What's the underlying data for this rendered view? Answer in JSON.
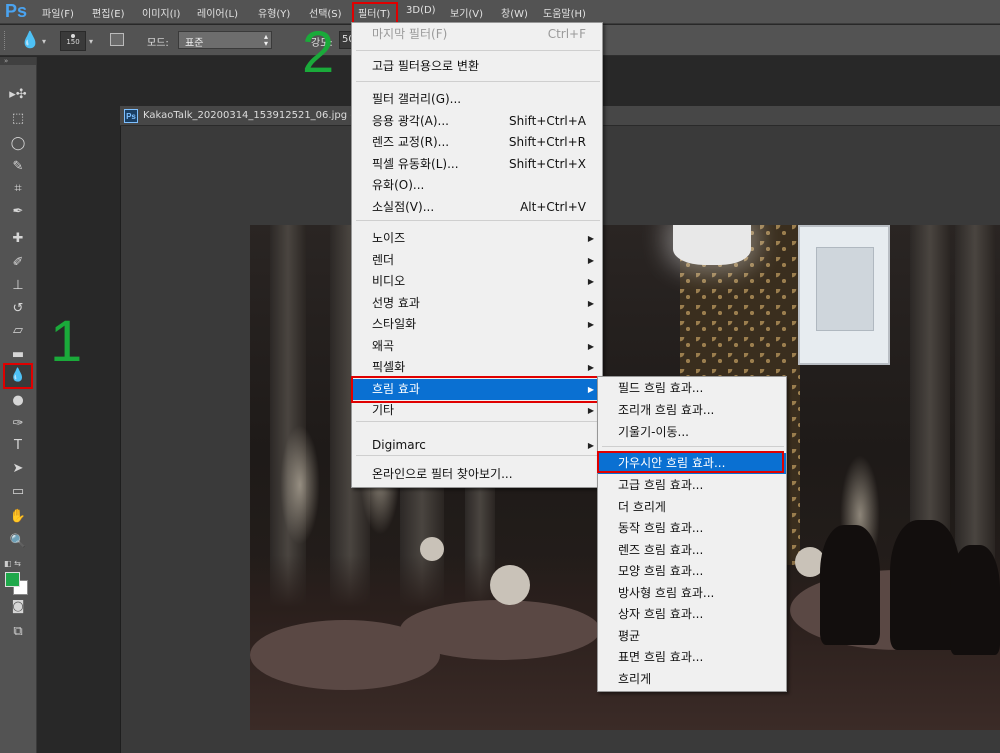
{
  "app": {
    "logo": "Ps"
  },
  "menubar": {
    "items": [
      "파일(F)",
      "편집(E)",
      "이미지(I)",
      "레이어(L)",
      "유형(Y)",
      "선택(S)",
      "필터(T)",
      "3D(D)",
      "보기(V)",
      "창(W)",
      "도움말(H)"
    ]
  },
  "options": {
    "brush_size": "150",
    "mode_label": "모드:",
    "mode_value": "표준",
    "strength_label": "강도:",
    "strength_value": "50"
  },
  "document": {
    "title": "KakaoTalk_20200314_153912521_06.jpg @",
    "icon_text": "Ps"
  },
  "annotations": {
    "step1": "1",
    "step2": "2"
  },
  "filter_menu": {
    "items": [
      {
        "label": "마지막 필터(F)",
        "shortcut": "Ctrl+F",
        "disabled": true
      },
      {
        "label": "고급 필터용으로 변환"
      },
      {
        "label": "필터 갤러리(G)..."
      },
      {
        "label": "응용 광각(A)...",
        "shortcut": "Shift+Ctrl+A"
      },
      {
        "label": "렌즈 교정(R)...",
        "shortcut": "Shift+Ctrl+R"
      },
      {
        "label": "픽셀 유동화(L)...",
        "shortcut": "Shift+Ctrl+X"
      },
      {
        "label": "유화(O)..."
      },
      {
        "label": "소실점(V)...",
        "shortcut": "Alt+Ctrl+V"
      },
      {
        "label": "노이즈",
        "submenu": true
      },
      {
        "label": "렌더",
        "submenu": true
      },
      {
        "label": "비디오",
        "submenu": true
      },
      {
        "label": "선명 효과",
        "submenu": true
      },
      {
        "label": "스타일화",
        "submenu": true
      },
      {
        "label": "왜곡",
        "submenu": true
      },
      {
        "label": "픽셀화",
        "submenu": true
      },
      {
        "label": "흐림 효과",
        "submenu": true,
        "highlighted": true
      },
      {
        "label": "기타",
        "submenu": true
      },
      {
        "label": "Digimarc",
        "submenu": true
      },
      {
        "label": "온라인으로 필터 찾아보기..."
      }
    ]
  },
  "blur_submenu": {
    "items": [
      {
        "label": "필드 흐림 효과..."
      },
      {
        "label": "조리개 흐림 효과..."
      },
      {
        "label": "기울기-이동..."
      },
      {
        "label": "가우시안 흐림 효과...",
        "highlighted": true
      },
      {
        "label": "고급 흐림 효과..."
      },
      {
        "label": "더 흐리게"
      },
      {
        "label": "동작 흐림 효과..."
      },
      {
        "label": "렌즈 흐림 효과..."
      },
      {
        "label": "모양 흐림 효과..."
      },
      {
        "label": "방사형 흐림 효과..."
      },
      {
        "label": "상자 흐림 효과..."
      },
      {
        "label": "평균"
      },
      {
        "label": "표면 흐림 효과..."
      },
      {
        "label": "흐리게"
      }
    ]
  },
  "tools": [
    {
      "name": "move-tool-icon",
      "glyph": "▸✣"
    },
    {
      "name": "marquee-tool-icon",
      "glyph": "⬚"
    },
    {
      "name": "lasso-tool-icon",
      "glyph": "◯"
    },
    {
      "name": "quick-selection-tool-icon",
      "glyph": "✎"
    },
    {
      "name": "crop-tool-icon",
      "glyph": "⌗"
    },
    {
      "name": "eyedropper-tool-icon",
      "glyph": "✒"
    },
    {
      "name": "healing-brush-tool-icon",
      "glyph": "✚"
    },
    {
      "name": "brush-tool-icon",
      "glyph": "✐"
    },
    {
      "name": "clone-stamp-tool-icon",
      "glyph": "⊥"
    },
    {
      "name": "history-brush-tool-icon",
      "glyph": "↺"
    },
    {
      "name": "eraser-tool-icon",
      "glyph": "▱"
    },
    {
      "name": "gradient-tool-icon",
      "glyph": "▬"
    },
    {
      "name": "blur-tool-icon",
      "glyph": "💧"
    },
    {
      "name": "dodge-tool-icon",
      "glyph": "●"
    },
    {
      "name": "pen-tool-icon",
      "glyph": "✑"
    },
    {
      "name": "type-tool-icon",
      "glyph": "T"
    },
    {
      "name": "path-selection-tool-icon",
      "glyph": "➤"
    },
    {
      "name": "rectangle-tool-icon",
      "glyph": "▭"
    },
    {
      "name": "hand-tool-icon",
      "glyph": "✋"
    },
    {
      "name": "zoom-tool-icon",
      "glyph": "🔍"
    },
    {
      "name": "quick-mask-icon",
      "glyph": "◙"
    },
    {
      "name": "screen-mode-icon",
      "glyph": "⧉"
    }
  ],
  "colors": {
    "accent_red": "#e00000",
    "annotation_green": "#1aaa3a",
    "menu_highlight": "#0a70d2",
    "foreground_swatch": "#1fa84a",
    "background_swatch": "#ffffff"
  }
}
